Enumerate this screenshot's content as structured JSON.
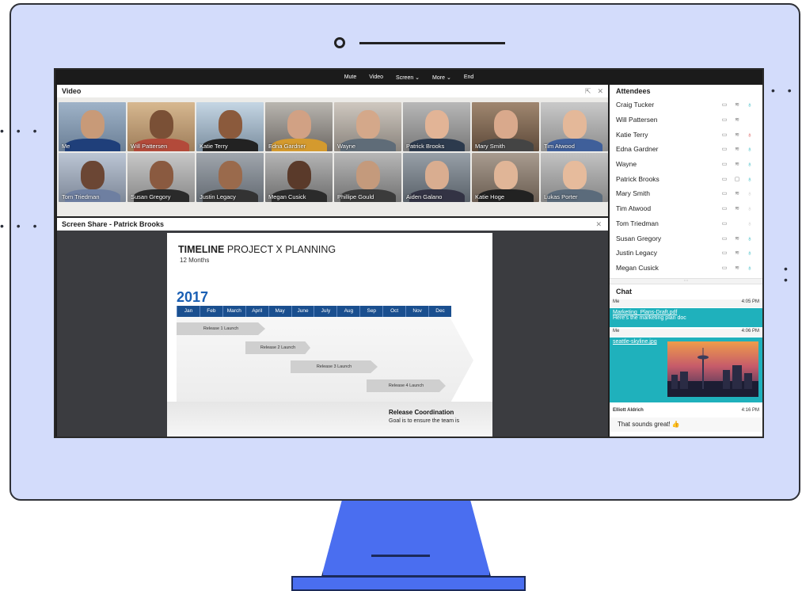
{
  "toolbar": {
    "mute": "Mute",
    "video": "Video",
    "screen": "Screen ⌄",
    "more": "More ⌄",
    "end": "End"
  },
  "video_panel": {
    "title": "Video",
    "participants": [
      {
        "name": "Me"
      },
      {
        "name": "Will Pattersen"
      },
      {
        "name": "Katie Terry"
      },
      {
        "name": "Edna Gardner"
      },
      {
        "name": "Wayne"
      },
      {
        "name": "Patrick Brooks"
      },
      {
        "name": "Mary Smith"
      },
      {
        "name": "Tim Atwood"
      },
      {
        "name": "Tom Triedman"
      },
      {
        "name": "Susan Gregory"
      },
      {
        "name": "Justin Legacy"
      },
      {
        "name": "Megan Cusick"
      },
      {
        "name": "Phillipe Gould"
      },
      {
        "name": "Aiden Galano"
      },
      {
        "name": "Katie Hoge"
      },
      {
        "name": "Lukas Porter"
      }
    ]
  },
  "share_panel": {
    "title": "Screen Share - Patrick Brooks",
    "slide": {
      "title_bold": "TIMELINE",
      "title_rest": " PROJECT X PLANNING",
      "subtitle": "12 Months",
      "year": "2017",
      "months": [
        "Jan",
        "Feb",
        "March",
        "April",
        "May",
        "June",
        "July",
        "Aug",
        "Sep",
        "Oct",
        "Nov",
        "Dec"
      ],
      "launches": [
        "Release 1 Launch",
        "Release 2 Launch",
        "Release 3 Launch",
        "Release 4 Launch"
      ],
      "coordination_title": "Release Coordination",
      "coordination_text": "Goal is to ensure the team is"
    }
  },
  "attendees": {
    "title": "Attendees",
    "list": [
      {
        "name": "Craig Tucker",
        "mic": "on"
      },
      {
        "name": "Will Pattersen",
        "mic": "none"
      },
      {
        "name": "Katie Terry",
        "mic": "muted"
      },
      {
        "name": "Edna Gardner",
        "mic": "on"
      },
      {
        "name": "Wayne",
        "mic": "on"
      },
      {
        "name": "Patrick Brooks",
        "mic": "on"
      },
      {
        "name": "Mary Smith",
        "mic": "off"
      },
      {
        "name": "Tim Atwood",
        "mic": "off"
      },
      {
        "name": "Tom Triedman",
        "mic": "off"
      },
      {
        "name": "Susan Gregory",
        "mic": "on"
      },
      {
        "name": "Justin Legacy",
        "mic": "on"
      },
      {
        "name": "Megan Cusick",
        "mic": "on"
      }
    ]
  },
  "chat": {
    "title": "Chat",
    "messages": [
      {
        "sender": "Me",
        "time": "4:05 PM",
        "link": "Marketing_Plans-Draft.pdf",
        "text": "Here's the marketing plan doc"
      },
      {
        "sender": "Me",
        "time": "4:06 PM",
        "link": "seattle-skyline.jpg"
      },
      {
        "sender": "Elliott Aldrich",
        "time": "4:16 PM",
        "text": "That sounds great! 👍"
      }
    ]
  },
  "colors": {
    "monitor": "#d3dcfb",
    "stand": "#4a6ef0",
    "accent": "#1fb1bc",
    "timeline_blue": "#1a4f8f"
  }
}
